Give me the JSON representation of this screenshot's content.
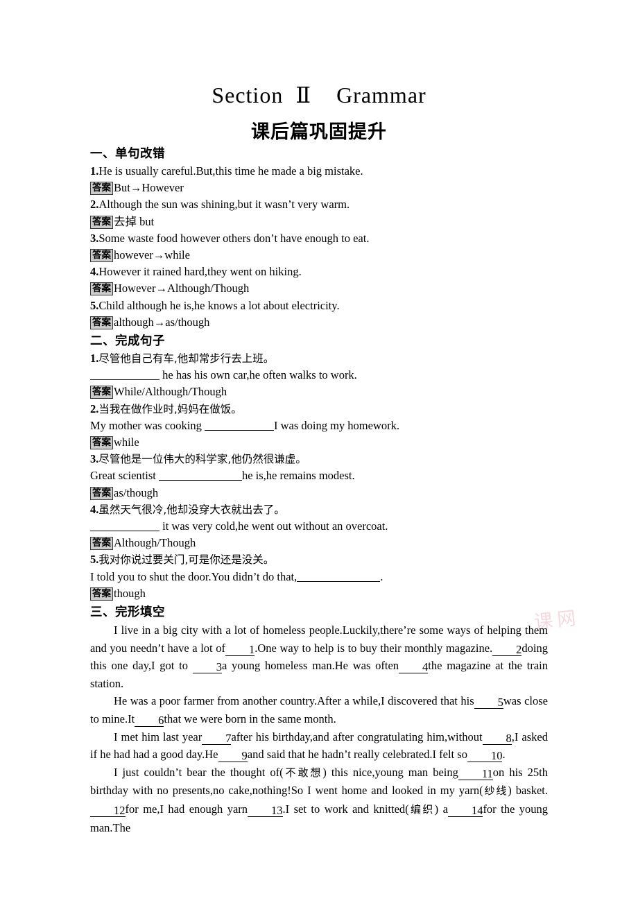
{
  "page": {
    "title_main": "Section  Ⅱ    Grammar",
    "title_sub": "课后篇巩固提升",
    "watermark": "课网"
  },
  "answer_tag": "答案",
  "sections": [
    {
      "heading": "一、单句改错",
      "items": [
        {
          "number": "1.",
          "question": "He is usually careful.But,this time he made a big mistake.",
          "answer": "But→However"
        },
        {
          "number": "2.",
          "question": "Although the sun was shining,but it wasn’t very warm.",
          "answer": "去掉 but"
        },
        {
          "number": "3.",
          "question": "Some waste food however others don’t have enough to eat.",
          "answer": "however→while"
        },
        {
          "number": "4.",
          "question": "However it rained hard,they went on hiking.",
          "answer": "However→Although/Though"
        },
        {
          "number": "5.",
          "question": "Child although he is,he knows a lot about electricity.",
          "answer": "although→as/though"
        }
      ]
    },
    {
      "heading": "二、完成句子",
      "items": [
        {
          "number": "1.",
          "chinese": "尽管他自己有车,他却常步行去上班。",
          "english_before": "",
          "english_after": " he has his own car,he often walks to work.",
          "blank_size": "b-md",
          "answer": "While/Although/Though"
        },
        {
          "number": "2.",
          "chinese": "当我在做作业时,妈妈在做饭。",
          "english_before": "My mother was cooking ",
          "english_after": "I was doing my homework.",
          "blank_size": "b-md",
          "answer": "while"
        },
        {
          "number": "3.",
          "chinese": "尽管他是一位伟大的科学家,他仍然很谦虚。",
          "english_before": "Great scientist ",
          "english_after": "he is,he remains modest.",
          "blank_size": "b-lg",
          "answer": "as/though"
        },
        {
          "number": "4.",
          "chinese": "虽然天气很冷,他却没穿大衣就出去了。",
          "english_before": "",
          "english_after": " it was very cold,he went out without an overcoat.",
          "blank_size": "b-md",
          "answer": "Although/Though"
        },
        {
          "number": "5.",
          "chinese": "我对你说过要关门,可是你还是没关。",
          "english_before": "I told you to shut the door.You didn’t do that,",
          "english_after": ".",
          "blank_size": "b-lg",
          "answer": "though"
        }
      ]
    },
    {
      "heading": "三、完形填空",
      "paragraphs": [
        {
          "parts": [
            {
              "t": "text",
              "v": "I live in a big city with a lot of homeless people.Luckily,there’re some ways of helping them and you needn’t have a lot of"
            },
            {
              "t": "blank",
              "v": "1"
            },
            {
              "t": "text",
              "v": ".One way to help is to buy their monthly magazine."
            },
            {
              "t": "blank",
              "v": "2"
            },
            {
              "t": "text",
              "v": "doing this one day,I got to "
            },
            {
              "t": "blank",
              "v": "3"
            },
            {
              "t": "text",
              "v": "a young homeless man.He was often"
            },
            {
              "t": "blank",
              "v": "4"
            },
            {
              "t": "text",
              "v": "the magazine at the train station."
            }
          ]
        },
        {
          "parts": [
            {
              "t": "text",
              "v": "He was a poor farmer from another country.After a while,I discovered that his"
            },
            {
              "t": "blank",
              "v": "5"
            },
            {
              "t": "text",
              "v": "was close to mine.It"
            },
            {
              "t": "blank",
              "v": "6"
            },
            {
              "t": "text",
              "v": "that we were born in the same month."
            }
          ]
        },
        {
          "parts": [
            {
              "t": "text",
              "v": "I met him last year"
            },
            {
              "t": "blank",
              "v": "7"
            },
            {
              "t": "text",
              "v": "after his birthday,and after congratulating him,without"
            },
            {
              "t": "blank",
              "v": "8"
            },
            {
              "t": "text",
              "v": ",I asked if he had had a good day.He"
            },
            {
              "t": "blank",
              "v": "9"
            },
            {
              "t": "text",
              "v": "and said that he hadn’t really celebrated.I felt so"
            },
            {
              "t": "blank",
              "v": "10"
            },
            {
              "t": "text",
              "v": "."
            }
          ]
        },
        {
          "parts": [
            {
              "t": "text",
              "v": "I just couldn’t bear the thought of("
            },
            {
              "t": "cn",
              "v": "不敢想"
            },
            {
              "t": "text",
              "v": ") this nice,young man being"
            },
            {
              "t": "blank",
              "v": "11"
            },
            {
              "t": "text",
              "v": "on his 25th birthday with no presents,no cake,nothing!So I went home and looked in my yarn("
            },
            {
              "t": "cn",
              "v": "纱线"
            },
            {
              "t": "text",
              "v": ") basket."
            },
            {
              "t": "blank",
              "v": "12"
            },
            {
              "t": "text",
              "v": "for me,I had enough yarn"
            },
            {
              "t": "blank",
              "v": "13"
            },
            {
              "t": "text",
              "v": ".I set to work and knitted("
            },
            {
              "t": "cn",
              "v": "编织"
            },
            {
              "t": "text",
              "v": ") a"
            },
            {
              "t": "blank",
              "v": "14"
            },
            {
              "t": "text",
              "v": "for the young man.The"
            }
          ]
        }
      ]
    }
  ]
}
